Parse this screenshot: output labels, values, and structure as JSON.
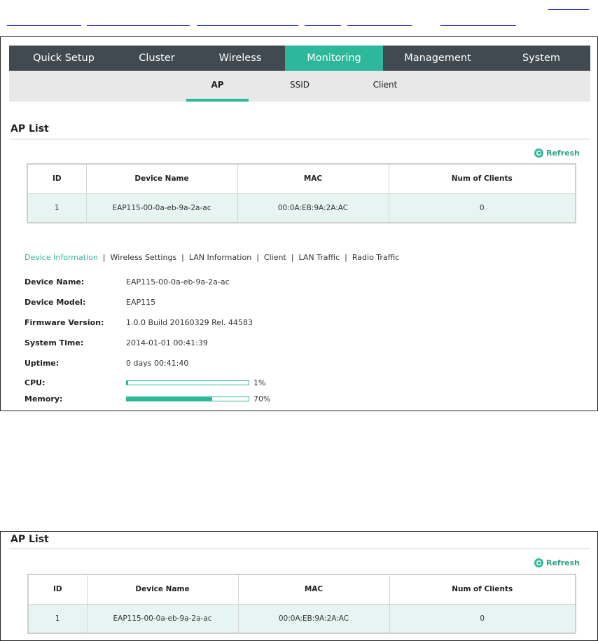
{
  "frame1": {
    "main_nav": [
      "Quick Setup",
      "Cluster",
      "Wireless",
      "Monitoring",
      "Management",
      "System"
    ],
    "main_nav_active": "Monitoring",
    "sub_nav": [
      "AP",
      "SSID",
      "Client"
    ],
    "sub_nav_active": "AP",
    "section_title": "AP List",
    "refresh_label": "Refresh",
    "table": {
      "headers": [
        "ID",
        "Device Name",
        "MAC",
        "Num of Clients"
      ],
      "rows": [
        [
          "1",
          "EAP115-00-0a-eb-9a-2a-ac",
          "00:0A:EB:9A:2A:AC",
          "0"
        ]
      ]
    },
    "detail_tabs": [
      "Device Information",
      "Wireless Settings",
      "LAN Information",
      "Client",
      "LAN Traffic",
      "Radio Traffic"
    ],
    "detail_tab_active": "Device Information",
    "info": [
      {
        "label": "Device Name:",
        "value": "EAP115-00-0a-eb-9a-2a-ac"
      },
      {
        "label": "Device Model:",
        "value": "EAP115"
      },
      {
        "label": "Firmware Version:",
        "value": "1.0.0 Build 20160329 Rel. 44583"
      },
      {
        "label": "System Time:",
        "value": "2014-01-01 00:41:39"
      },
      {
        "label": "Uptime:",
        "value": "0 days 00:41:40"
      }
    ],
    "cpu": {
      "label": "CPU:",
      "percent_text": "1%",
      "level": 0.01
    },
    "memory": {
      "label": "Memory:",
      "percent_text": "70%",
      "level": 0.7
    }
  },
  "frame2": {
    "section_title": "AP List",
    "refresh_label": "Refresh",
    "table": {
      "headers": [
        "ID",
        "Device Name",
        "MAC",
        "Num of Clients"
      ],
      "rows": [
        [
          "1",
          "EAP115-00-0a-eb-9a-2a-ac",
          "00:0A:EB:9A:2A:AC",
          "0"
        ]
      ]
    }
  },
  "colors": {
    "accent": "#2db89b",
    "nav_bg": "#414a50",
    "subnav_bg": "#e8e8e8",
    "row_bg": "#e6f5f1",
    "link_underline": "#2233cc"
  },
  "icons": {
    "refresh": "refresh-icon"
  }
}
